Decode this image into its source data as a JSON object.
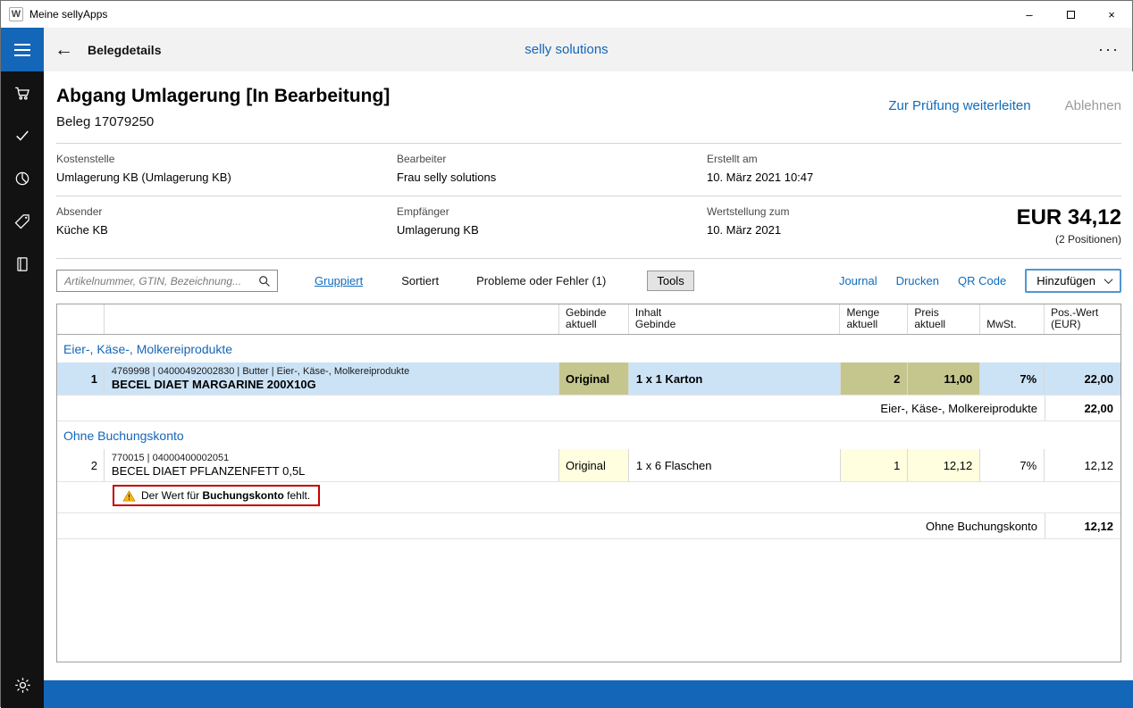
{
  "colors": {
    "accent": "#1466b8",
    "link_blue": "#0f6cbd",
    "selected_row": "#cce3f6",
    "editable_cell": "#ffffe0",
    "editable_cell_selected": "#c5c68e",
    "warning_border": "#c00000",
    "sidebar_bg": "#121212",
    "header_bg": "#f2f2f2"
  },
  "icons": {
    "back": "←",
    "more": "···",
    "minimize": "–",
    "close": "×",
    "app_logo": "W",
    "hamburger": "bars",
    "cart": "svg-shape",
    "check": "svg-shape",
    "pie_chart": "svg-shape",
    "price_tag": "svg-shape",
    "journal_book": "svg-shape",
    "gear": "svg-shape",
    "search": "svg-shape",
    "chevron_down": "css-shape",
    "warning": "svg-shape"
  },
  "window": {
    "title": "Meine sellyApps"
  },
  "header": {
    "title": "Belegdetails",
    "brand": "selly solutions"
  },
  "document": {
    "title": "Abgang Umlagerung [In Bearbeitung]",
    "subtitle": "Beleg 17079250",
    "action_forward": "Zur Prüfung weiterleiten",
    "action_reject": "Ablehnen",
    "fields_row1": [
      {
        "label": "Kostenstelle",
        "value": "Umlagerung KB (Umlagerung KB)"
      },
      {
        "label": "Bearbeiter",
        "value": "Frau selly solutions"
      },
      {
        "label": "Erstellt am",
        "value": "10. März 2021 10:47"
      }
    ],
    "fields_row2": [
      {
        "label": "Absender",
        "value": "Küche KB"
      },
      {
        "label": "Empfänger",
        "value": "Umlagerung KB"
      },
      {
        "label": "Wertstellung zum",
        "value": "10. März 2021"
      }
    ],
    "total_amount": "EUR 34,12",
    "total_positions": "(2 Positionen)"
  },
  "toolbar": {
    "search_placeholder": "Artikelnummer, GTIN, Bezeichnung...",
    "grouped": "Gruppiert",
    "sorted": "Sortiert",
    "problems": "Probleme oder Fehler (1)",
    "tools": "Tools",
    "journal": "Journal",
    "print": "Drucken",
    "qr": "QR Code",
    "add": "Hinzufügen"
  },
  "table": {
    "headers": {
      "gebinde": "Gebinde\naktuell",
      "inhalt": "Inhalt\nGebinde",
      "menge": "Menge\naktuell",
      "preis": "Preis\naktuell",
      "mwst": "MwSt.",
      "wert": "Pos.-Wert\n(EUR)"
    },
    "group1": {
      "name": "Eier-, Käse-, Molkereiprodukte",
      "row": {
        "num": "1",
        "meta": "4769998 | 04000492002830 | Butter | Eier-, Käse-, Molkereiprodukte",
        "name": "BECEL DIAET MARGARINE 200X10G",
        "gebinde": "Original",
        "inhalt": "1 x 1 Karton",
        "menge": "2",
        "preis": "11,00",
        "mwst": "7%",
        "wert": "22,00"
      },
      "subtotal_label": "Eier-, Käse-, Molkereiprodukte",
      "subtotal_value": "22,00"
    },
    "group2": {
      "name": "Ohne Buchungskonto",
      "row": {
        "num": "2",
        "meta": "770015 | 04000400002051",
        "name": "BECEL DIAET PFLANZENFETT 0,5L",
        "gebinde": "Original",
        "inhalt": "1 x 6 Flaschen",
        "menge": "1",
        "preis": "12,12",
        "mwst": "7%",
        "wert": "12,12"
      },
      "warning_prefix": "Der Wert für ",
      "warning_bold": "Buchungskonto",
      "warning_suffix": " fehlt.",
      "subtotal_label": "Ohne Buchungskonto",
      "subtotal_value": "12,12"
    }
  }
}
